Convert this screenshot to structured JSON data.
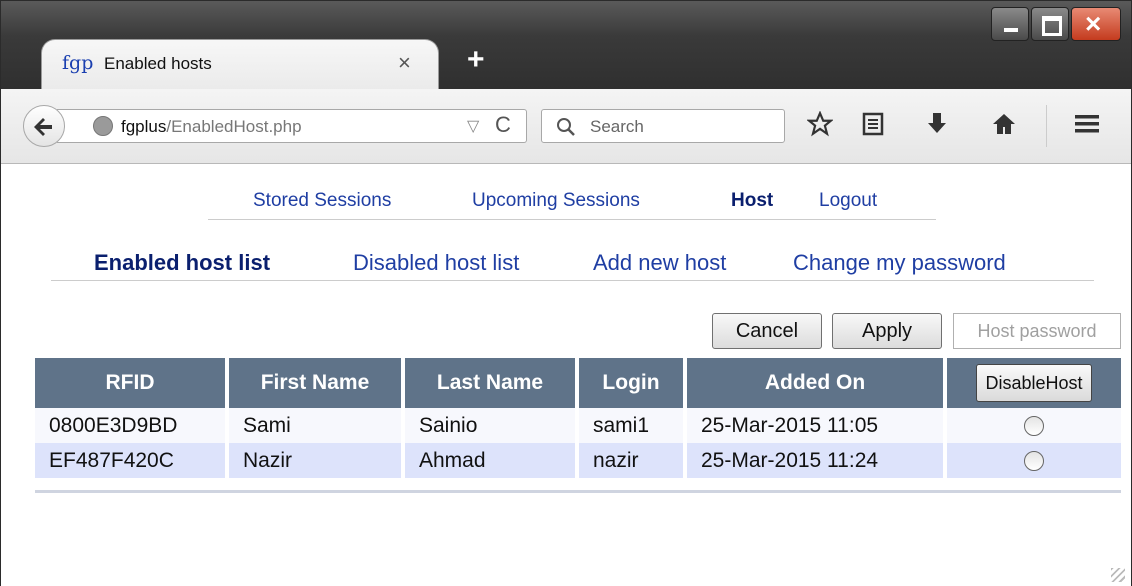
{
  "browser": {
    "tab": {
      "favicon_text": "fgp",
      "title": "Enabled hosts",
      "close": "×"
    },
    "newtab": "+",
    "window_controls": {
      "close": "×"
    },
    "url": {
      "host": "fgplus",
      "path": "/EnabledHost.php",
      "dropdown": "▽",
      "reload": "C"
    },
    "search": {
      "placeholder": "Search",
      "icon": "search-icon"
    },
    "toolbar_icons": [
      "star-icon",
      "reading-list-icon",
      "download-icon",
      "home-icon",
      "menu-icon"
    ]
  },
  "menu_primary": {
    "items": [
      "Stored Sessions",
      "Upcoming Sessions",
      "Host",
      "Logout"
    ],
    "active": "Host"
  },
  "menu_secondary": {
    "items": [
      "Enabled host list",
      "Disabled host list",
      "Add new host",
      "Change my password"
    ],
    "active": "Enabled host list"
  },
  "actions": {
    "cancel": "Cancel",
    "apply": "Apply",
    "host_password": "Host password"
  },
  "table": {
    "columns": [
      "RFID",
      "First Name",
      "Last Name",
      "Login",
      "Added On"
    ],
    "action_header": "DisableHost",
    "rows": [
      {
        "rfid": "0800E3D9BD",
        "first": "Sami",
        "last": "Sainio",
        "login": "sami1",
        "added": "25-Mar-2015 11:05"
      },
      {
        "rfid": "EF487F420C",
        "first": "Nazir",
        "last": "Ahmad",
        "login": "nazir",
        "added": "25-Mar-2015 11:24"
      }
    ]
  },
  "colors": {
    "header_bg": "#5f7389",
    "link": "#1f3ea3",
    "link_active": "#0a1f6e",
    "row_alt": "#dde3fb"
  }
}
